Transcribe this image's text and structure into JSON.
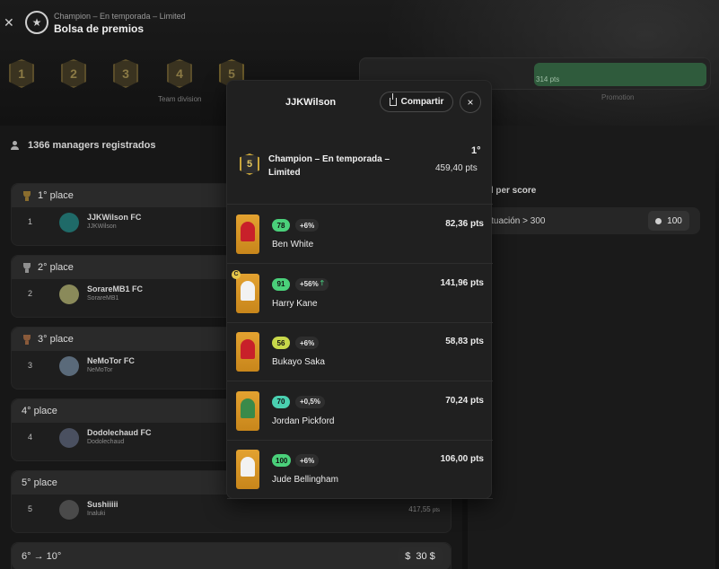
{
  "header": {
    "subtitle": "Champion – En temporada – Limited",
    "title": "Bolsa de premios"
  },
  "divisions": [
    "1",
    "2",
    "3",
    "4",
    "5"
  ],
  "division_label": "Team division",
  "promotion": {
    "points_text": "314 pts",
    "label": "Promotion"
  },
  "managers_text": "1366 managers registrados",
  "places": [
    {
      "label": "1° place",
      "trophy": "gold",
      "rank": "1",
      "team": "JJKWilson FC",
      "manager": "JJKWilson",
      "avatar_color": "#1f6a68"
    },
    {
      "label": "2° place",
      "trophy": "silver",
      "rank": "2",
      "team": "SorareMB1 FC",
      "manager": "SorareMB1",
      "avatar_color": "#8a8a5a"
    },
    {
      "label": "3° place",
      "trophy": "bronze",
      "rank": "3",
      "team": "NeMoTor FC",
      "manager": "NeMoTor",
      "avatar_color": "#5a6a7a"
    },
    {
      "label": "4° place",
      "trophy": "",
      "rank": "4",
      "team": "Dodolechaud FC",
      "manager": "Dodolechaud",
      "avatar_color": "#4a5060"
    },
    {
      "label": "5° place",
      "trophy": "",
      "rank": "5",
      "team": "Sushiiiii",
      "manager": "Inaluki",
      "avatar_color": "#4a4a4a",
      "pts": "417,55",
      "pts_unit": "pts"
    }
  ],
  "range_label": "6° → 10°",
  "range_prize": "30 $",
  "range_prize_symbol": "$",
  "right_panel": {
    "title": "ard per score",
    "row_label": "untuación > 300",
    "row_value": "100"
  },
  "modal": {
    "user": "JJKWilson",
    "share_label": "Compartir",
    "close_label": "×",
    "division": "5",
    "competition": "Champion – En temporada – Limited",
    "rank": "1°",
    "total": "459,40 pts",
    "players": [
      {
        "name": "Ben White",
        "score": "78",
        "score_color": "#4ad07a",
        "bonus": "+6%",
        "arrow": "",
        "pts": "82,36 pts",
        "captain": false,
        "kit": "#c8202a"
      },
      {
        "name": "Harry Kane",
        "score": "91",
        "score_color": "#4ad07a",
        "bonus": "+56%",
        "arrow": "🡑",
        "pts": "141,96 pts",
        "captain": true,
        "captain_label": "C",
        "kit": "#f2f2f2"
      },
      {
        "name": "Bukayo Saka",
        "score": "56",
        "score_color": "#c8d84a",
        "bonus": "+6%",
        "arrow": "",
        "pts": "58,83 pts",
        "captain": false,
        "kit": "#c8202a"
      },
      {
        "name": "Jordan Pickford",
        "score": "70",
        "score_color": "#4ad0b0",
        "bonus": "+0,5%",
        "arrow": "",
        "pts": "70,24 pts",
        "captain": false,
        "kit": "#3a8a4a"
      },
      {
        "name": "Jude Bellingham",
        "score": "100",
        "score_color": "#4ad07a",
        "bonus": "+6%",
        "arrow": "",
        "pts": "106,00 pts",
        "captain": false,
        "kit": "#f2f2f2"
      }
    ]
  }
}
